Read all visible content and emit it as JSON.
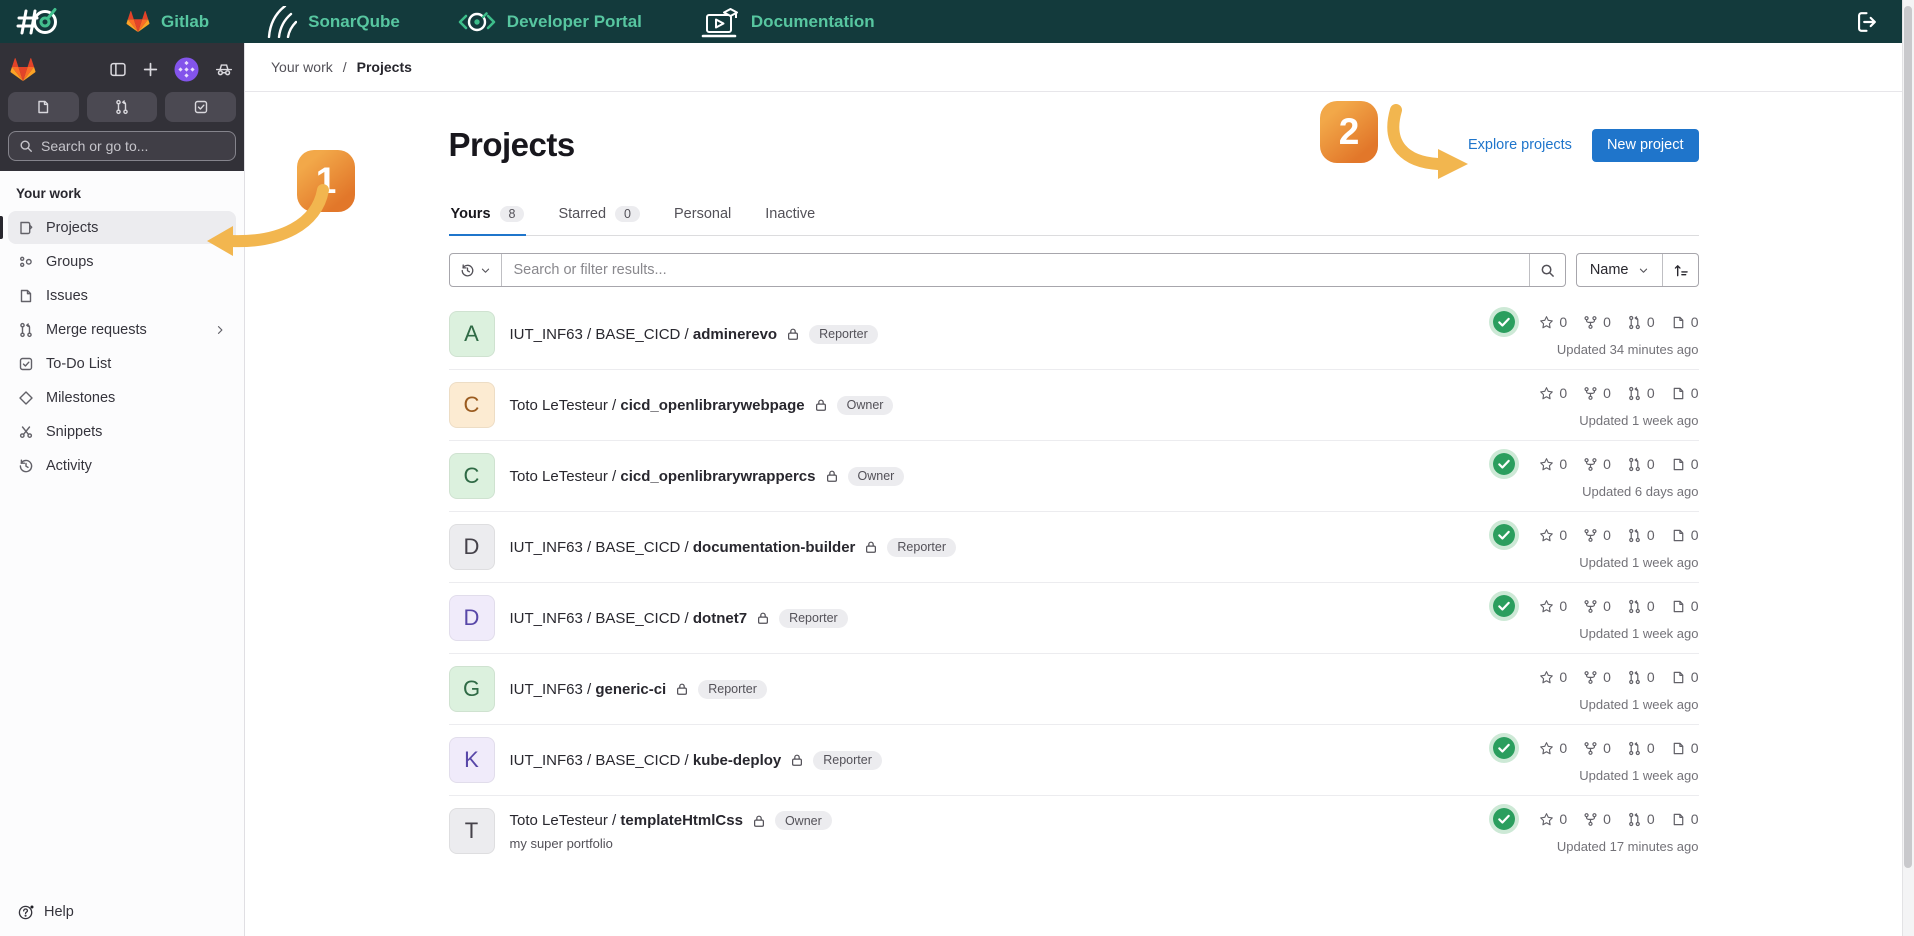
{
  "top_nav": {
    "logo_icon": "hash-target-logo",
    "links": [
      {
        "label": "Gitlab",
        "icon": "gitlab-tanuki-icon"
      },
      {
        "label": "SonarQube",
        "icon": "sonarqube-waves-icon"
      },
      {
        "label": "Developer Portal",
        "icon": "developer-portal-icon"
      },
      {
        "label": "Documentation",
        "icon": "documentation-laptop-icon"
      }
    ],
    "logout_icon": "logout-icon",
    "colors": {
      "bar_bg": "#133a3c",
      "link_text": "#57c6a0"
    }
  },
  "sidebar": {
    "search_placeholder": "Search or go to...",
    "section_title": "Your work",
    "items": [
      {
        "label": "Projects",
        "icon": "projects-icon",
        "active": true
      },
      {
        "label": "Groups",
        "icon": "groups-icon"
      },
      {
        "label": "Issues",
        "icon": "issues-icon"
      },
      {
        "label": "Merge requests",
        "icon": "merge-request-icon",
        "has_chevron": true
      },
      {
        "label": "To-Do List",
        "icon": "todo-icon"
      },
      {
        "label": "Milestones",
        "icon": "milestone-icon"
      },
      {
        "label": "Snippets",
        "icon": "snippets-icon"
      },
      {
        "label": "Activity",
        "icon": "activity-icon"
      }
    ],
    "help_label": "Help"
  },
  "breadcrumb": {
    "parent": "Your work",
    "separator": "/",
    "current": "Projects"
  },
  "page": {
    "title": "Projects",
    "explore_link": "Explore projects",
    "new_project_button": "New project",
    "tabs": [
      {
        "label": "Yours",
        "count": "8",
        "active": true
      },
      {
        "label": "Starred",
        "count": "0"
      },
      {
        "label": "Personal"
      },
      {
        "label": "Inactive"
      }
    ],
    "filter_placeholder": "Search or filter results...",
    "sort_label": "Name"
  },
  "annotations": {
    "step_1": "1",
    "step_2": "2",
    "arrow_color": "#f2b64f",
    "badge_color": "#e8883a"
  },
  "colors": {
    "accent_blue": "#1f75cb",
    "pipeline_success": "#2b9e5e",
    "active_item_bg": "#ececef",
    "muted_text": "#737278"
  },
  "projects": [
    {
      "initial": "A",
      "avatar_bg": "#dcf1de",
      "avatar_fg": "#2f6a45",
      "namespace": "IUT_INF63 / BASE_CICD / ",
      "name": "adminerevo",
      "role": "Reporter",
      "pipeline_passed": true,
      "stars": "0",
      "forks": "0",
      "merge_requests": "0",
      "issues": "0",
      "updated": "Updated 34 minutes ago",
      "description": ""
    },
    {
      "initial": "C",
      "avatar_bg": "#fcebd2",
      "avatar_fg": "#9a5b1f",
      "namespace": "Toto LeTesteur / ",
      "name": "cicd_openlibrarywebpage",
      "role": "Owner",
      "pipeline_passed": false,
      "stars": "0",
      "forks": "0",
      "merge_requests": "0",
      "issues": "0",
      "updated": "Updated 1 week ago",
      "description": ""
    },
    {
      "initial": "C",
      "avatar_bg": "#dcf1de",
      "avatar_fg": "#2f6a45",
      "namespace": "Toto LeTesteur / ",
      "name": "cicd_openlibrarywrappercs",
      "role": "Owner",
      "pipeline_passed": true,
      "stars": "0",
      "forks": "0",
      "merge_requests": "0",
      "issues": "0",
      "updated": "Updated 6 days ago",
      "description": ""
    },
    {
      "initial": "D",
      "avatar_bg": "#ececef",
      "avatar_fg": "#45424a",
      "namespace": "IUT_INF63 / BASE_CICD / ",
      "name": "documentation-builder",
      "role": "Reporter",
      "pipeline_passed": true,
      "stars": "0",
      "forks": "0",
      "merge_requests": "0",
      "issues": "0",
      "updated": "Updated 1 week ago",
      "description": ""
    },
    {
      "initial": "D",
      "avatar_bg": "#f0ebfa",
      "avatar_fg": "#5847a8",
      "namespace": "IUT_INF63 / BASE_CICD / ",
      "name": "dotnet7",
      "role": "Reporter",
      "pipeline_passed": true,
      "stars": "0",
      "forks": "0",
      "merge_requests": "0",
      "issues": "0",
      "updated": "Updated 1 week ago",
      "description": ""
    },
    {
      "initial": "G",
      "avatar_bg": "#dcf1de",
      "avatar_fg": "#2f6a45",
      "namespace": "IUT_INF63 / ",
      "name": "generic-ci",
      "role": "Reporter",
      "pipeline_passed": false,
      "stars": "0",
      "forks": "0",
      "merge_requests": "0",
      "issues": "0",
      "updated": "Updated 1 week ago",
      "description": ""
    },
    {
      "initial": "K",
      "avatar_bg": "#f0ebfa",
      "avatar_fg": "#5847a8",
      "namespace": "IUT_INF63 / BASE_CICD / ",
      "name": "kube-deploy",
      "role": "Reporter",
      "pipeline_passed": true,
      "stars": "0",
      "forks": "0",
      "merge_requests": "0",
      "issues": "0",
      "updated": "Updated 1 week ago",
      "description": ""
    },
    {
      "initial": "T",
      "avatar_bg": "#ececef",
      "avatar_fg": "#45424a",
      "namespace": "Toto LeTesteur / ",
      "name": "templateHtmlCss",
      "role": "Owner",
      "pipeline_passed": true,
      "stars": "0",
      "forks": "0",
      "merge_requests": "0",
      "issues": "0",
      "updated": "Updated 17 minutes ago",
      "description": "my super portfolio"
    }
  ]
}
